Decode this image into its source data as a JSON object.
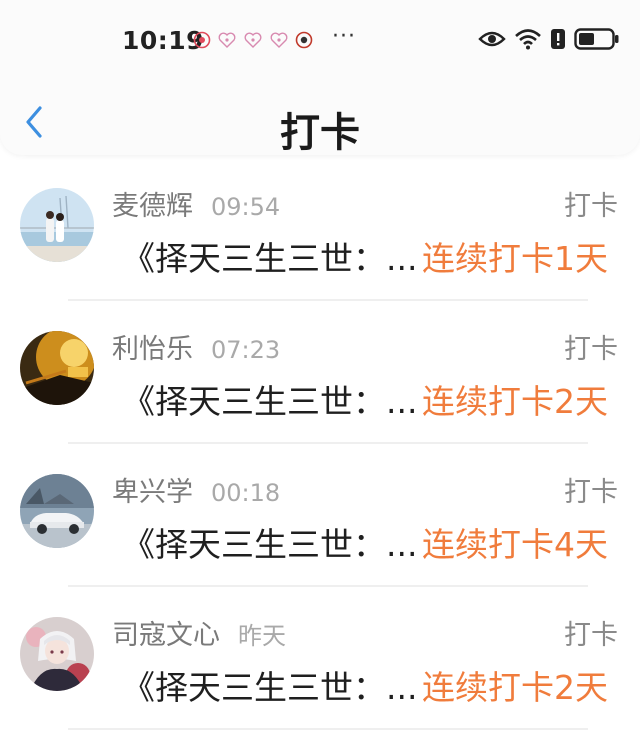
{
  "status_bar": {
    "time": "10:19",
    "more": "···",
    "notification_icons": [
      "app-notification-icon",
      "heart-icon",
      "heart-icon",
      "heart-icon",
      "app-notification-icon"
    ],
    "system_icons": [
      "eye-icon",
      "wifi-icon",
      "alert-icon",
      "battery-icon"
    ]
  },
  "header": {
    "back_icon": "chevron-left-icon",
    "title": "打卡"
  },
  "colors": {
    "accent_blue": "#3d8fe0",
    "streak_orange": "#f07c3c"
  },
  "items": [
    {
      "name": "麦德辉",
      "time": "09:54",
      "action": "打卡",
      "book": "《择天三生三世：...",
      "streak": "连续打卡1天"
    },
    {
      "name": "利怡乐",
      "time": "07:23",
      "action": "打卡",
      "book": "《择天三生三世：...",
      "streak": "连续打卡2天"
    },
    {
      "name": "卑兴学",
      "time": "00:18",
      "action": "打卡",
      "book": "《择天三生三世：...",
      "streak": "连续打卡4天"
    },
    {
      "name": "司寇文心",
      "time": "昨天",
      "action": "打卡",
      "book": "《择天三生三世：...",
      "streak": "连续打卡2天"
    }
  ]
}
